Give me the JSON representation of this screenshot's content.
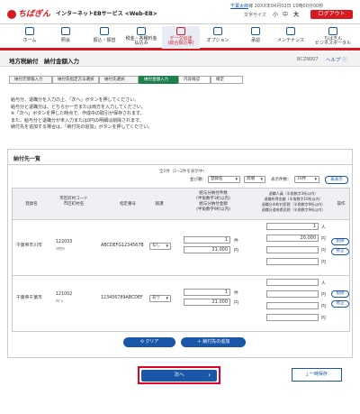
{
  "header": {
    "logo_text": "ちばぎん",
    "service_name": "インターネットEBサービス <Web-EB>",
    "user_name": "千葉太郎",
    "user_suffix": "様",
    "last_login": "20XX年04月02日 10時00分00秒",
    "font_size_label": "文字サイズ",
    "font_sizes": [
      "小",
      "中",
      "大"
    ],
    "logout_label": "ログアウト"
  },
  "nav": [
    {
      "label": "ホーム",
      "icon": "home-icon"
    },
    {
      "label": "照会",
      "icon": "inquiry-icon"
    },
    {
      "label": "振込・振替",
      "icon": "transfer-icon"
    },
    {
      "label": "税金・各種料金\n払込み",
      "icon": "tax-icon"
    },
    {
      "label": "データ伝送\n(総合振込等)",
      "icon": "data-transfer-icon"
    },
    {
      "label": "オプション",
      "icon": "option-icon"
    },
    {
      "label": "承認",
      "icon": "approve-icon"
    },
    {
      "label": "メンテナンス",
      "icon": "maintenance-icon"
    },
    {
      "label": "ちばぎん\nビジネスポータル",
      "icon": "portal-icon"
    }
  ],
  "page": {
    "title": "地方税納付　納付金額入力",
    "code": "BCZN007",
    "help_label": "ヘルプ"
  },
  "steps": [
    "納付元情報入力",
    "納付先指定方法選択",
    "納付先選択",
    "納付金額入力",
    "内容確認",
    "確定"
  ],
  "message": [
    "給与分、退職分を入力の上、「次へ」ボタンを押してください。",
    "給与分と退職分は、どちらか一方または両方を入力してください。",
    "※「次へ」ボタンを押した時点で、作成中の取引が保存されます。",
    "また、給与分と退職分が未入力または0円の明細は削除されます。",
    "納付先を追加する場合は、「納付先の追加」ボタンを押してください。"
  ],
  "list": {
    "title": "納付先一覧",
    "count_text": "全2件（1~2件を表示中）",
    "sort_label": "並び順：",
    "sort_value": "登録名",
    "order_value": "昇順",
    "display_count_label": "表示件数：",
    "display_count_value": "10件",
    "redisplay_label": "再表示",
    "headers": {
      "name": "登録名",
      "city": "市区町村コード\n市区町村名",
      "number": "指定番号",
      "flag": "賦課",
      "salary": "給与分納付件数\n(半角数字3桁以内)\n給与分納付金額\n(半角数字9桁以内)",
      "retire": "退職人員（半角数字3桁以内）\n退職所得金額（半角数字10桁以内）\n退職分市町村民税（半角数字9桁以内）\n退職分道府県民税（半角数字9桁以内）",
      "op": "操作"
    },
    "rows": [
      {
        "name": "千葉県市川市",
        "city_code": "122033",
        "city_name": "ｲﾁｶﾜｼ",
        "number": "ABCDEFG1234567B",
        "flag": "なし",
        "salary_count": "1",
        "salary_amount": "21,000",
        "retire_count": "1",
        "retire_income": "20,000",
        "retire_city": "",
        "retire_pref": "",
        "unit_count": "件",
        "unit_yen": "円",
        "unit_person": "人",
        "op1": "削除",
        "op2": "修正"
      },
      {
        "name": "千葉県千葉市",
        "city_code": "121002",
        "city_name": "ﾁﾊﾞｼ",
        "number": "123456789ABCDEF",
        "flag": "あり",
        "salary_count": "1",
        "salary_amount": "21,000",
        "retire_count": "",
        "retire_income": "",
        "retire_city": "",
        "retire_pref": "",
        "unit_count": "件",
        "unit_yen": "円",
        "unit_person": "人",
        "op1": "削除",
        "op2": "修正"
      }
    ],
    "clear_label": "クリア",
    "add_label": "納付先の追加"
  },
  "footer": {
    "next_label": "次へ",
    "save_label": "一時保存"
  }
}
